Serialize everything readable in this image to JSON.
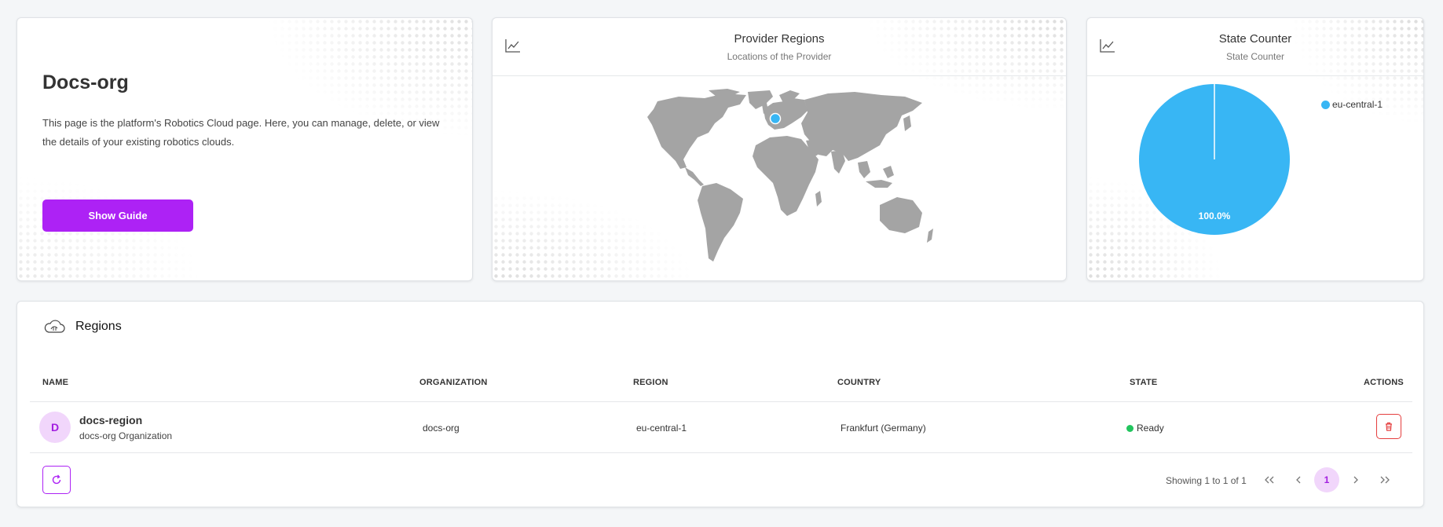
{
  "info": {
    "title": "Docs-org",
    "description": "This page is the platform's Robotics Cloud page. Here, you can manage, delete, or view the details of your existing robotics clouds.",
    "guide_button": "Show Guide"
  },
  "map_card": {
    "title": "Provider Regions",
    "subtitle": "Locations of the Provider",
    "icon": "chart-line-icon"
  },
  "pie_card": {
    "title": "State Counter",
    "subtitle": "State Counter",
    "icon": "chart-line-icon",
    "legend_label": "eu-central-1",
    "slice_label": "100.0%",
    "color": "#38b6f4"
  },
  "chart_data": {
    "type": "pie",
    "categories": [
      "eu-central-1"
    ],
    "values": [
      100.0
    ],
    "title": "State Counter",
    "legend_position": "top-right"
  },
  "regions": {
    "title": "Regions",
    "icon": "cloud-brain-icon",
    "columns": [
      "NAME",
      "ORGANIZATION",
      "REGION",
      "COUNTRY",
      "STATE",
      "ACTIONS"
    ],
    "rows": [
      {
        "avatar": "D",
        "name": "docs-region",
        "sub": "docs-org Organization",
        "organization": "docs-org",
        "region": "eu-central-1",
        "country": "Frankfurt (Germany)",
        "state": "Ready"
      }
    ],
    "showing": "Showing 1 to 1 of 1",
    "page": "1",
    "accent": "#ad22f5",
    "ready_color": "#22c55e"
  }
}
